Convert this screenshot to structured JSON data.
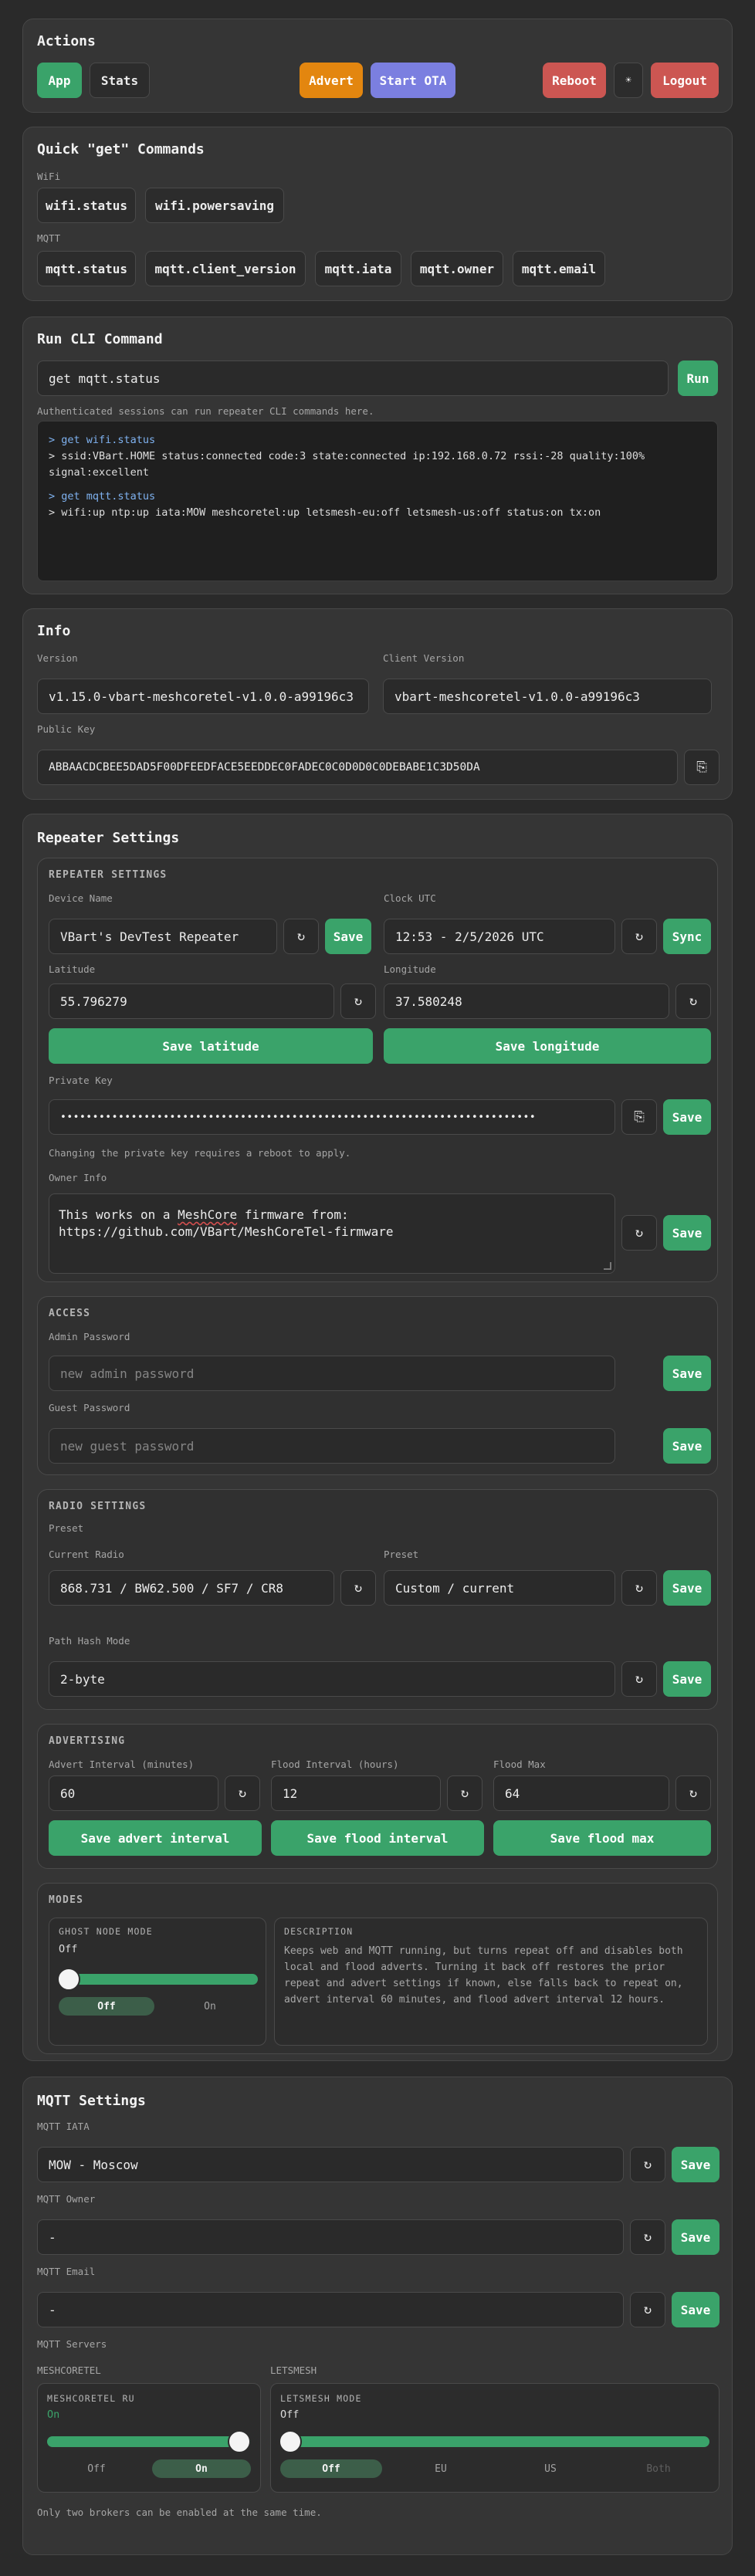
{
  "actions": {
    "title": "Actions",
    "app": "App",
    "stats": "Stats",
    "advert": "Advert",
    "start_ota": "Start OTA",
    "reboot": "Reboot",
    "theme_icon": "☀",
    "logout": "Logout"
  },
  "quick": {
    "title": "Quick \"get\" Commands",
    "wifi_label": "WiFi",
    "wifi_cmds": [
      "wifi.status",
      "wifi.powersaving"
    ],
    "mqtt_label": "MQTT",
    "mqtt_cmds": [
      "mqtt.status",
      "mqtt.client_version",
      "mqtt.iata",
      "mqtt.owner",
      "mqtt.email"
    ]
  },
  "cli": {
    "title": "Run CLI Command",
    "input_value": "get mqtt.status",
    "run": "Run",
    "note": "Authenticated sessions can run repeater CLI commands here.",
    "log": [
      {
        "cmd": "> get wifi.status",
        "out": "> ssid:VBart.HOME status:connected code:3 state:connected ip:192.168.0.72 rssi:-28 quality:100% signal:excellent"
      },
      {
        "cmd": "> get mqtt.status",
        "out": "> wifi:up ntp:up iata:MOW meshcoretel:up letsmesh-eu:off letsmesh-us:off status:on tx:on"
      }
    ]
  },
  "info": {
    "title": "Info",
    "version_label": "Version",
    "version": "v1.15.0-vbart-meshcoretel-v1.0.0-a99196c3",
    "client_label": "Client Version",
    "client": "vbart-meshcoretel-v1.0.0-a99196c3",
    "pubkey_label": "Public Key",
    "pubkey": "ABBAACDCBEE5DAD5F00DFEEDFACE5EEDDEC0FADEC0C0D0D0C0DEBABE1C3D50DA",
    "copy_icon": "⎘"
  },
  "repeater": {
    "title": "Repeater Settings",
    "section": "REPEATER SETTINGS",
    "name_label": "Device Name",
    "name": "VBart's DevTest Repeater",
    "clock_label": "Clock UTC",
    "clock": "12:53 - 2/5/2026 UTC",
    "sync": "Sync",
    "lat_label": "Latitude",
    "lat": "55.796279",
    "lon_label": "Longitude",
    "lon": "37.580248",
    "save_lat": "Save latitude",
    "save_lon": "Save longitude",
    "pk_label": "Private Key",
    "pk": "••••••••••••••••••••••••••••••••••••••••••••••••••••••••••••••••••••••••••",
    "pk_note": "Changing the private key requires a reboot to apply.",
    "owner_label": "Owner Info",
    "owner_pre": "This works on a ",
    "owner_word": "MeshCore",
    "owner_post": " firmware from:\nhttps://github.com/VBart/MeshCoreTel-firmware"
  },
  "access": {
    "section": "ACCESS",
    "admin_label": "Admin Password",
    "admin_ph": "new admin password",
    "guest_label": "Guest Password",
    "guest_ph": "new guest password"
  },
  "radio": {
    "section": "RADIO SETTINGS",
    "preset_label": "Preset",
    "current_label": "Current Radio",
    "current": "868.731 / BW62.500 / SF7 / CR8",
    "preset_label2": "Preset",
    "preset": "Custom / current",
    "path_label": "Path Hash Mode",
    "path": "2-byte"
  },
  "advert": {
    "section": "ADVERTISING",
    "interval_label": "Advert Interval (minutes)",
    "interval": "60",
    "flood_label": "Flood Interval (hours)",
    "flood": "12",
    "floodmax_label": "Flood Max",
    "floodmax": "64",
    "save_interval": "Save advert interval",
    "save_flood": "Save flood interval",
    "save_floodmax": "Save flood max"
  },
  "modes": {
    "section": "MODES",
    "ghost_title": "GHOST NODE MODE",
    "ghost_value": "Off",
    "ghost_level": 0,
    "seg_off": "Off",
    "seg_on": "On",
    "desc_title": "DESCRIPTION",
    "desc": "Keeps web and MQTT running, but turns repeat off and disables both local and flood adverts. Turning it back off restores the prior repeat and advert settings if known, else falls back to repeat on, advert interval 60 minutes, and flood advert interval 12 hours."
  },
  "mqtt": {
    "title": "MQTT Settings",
    "iata_label": "MQTT IATA",
    "iata": "MOW - Moscow",
    "owner_label": "MQTT Owner",
    "owner": "-",
    "email_label": "MQTT Email",
    "email": "-",
    "servers_label": "MQTT Servers",
    "meshcoretel_label": "MESHCORETEL",
    "letsmesh_label": "LETSMESH",
    "ru_title": "MESHCORETEL RU",
    "ru_value": "On",
    "ru_level": 1,
    "ru_off": "Off",
    "ru_on": "On",
    "lm_title": "LETSMESH MODE",
    "lm_value": "Off",
    "lm_level": 0,
    "lm_off": "Off",
    "lm_eu": "EU",
    "lm_us": "US",
    "lm_both": "Both",
    "note": "Only two brokers can be enabled at the same time."
  },
  "common": {
    "save": "Save",
    "refresh_icon": "↻"
  }
}
